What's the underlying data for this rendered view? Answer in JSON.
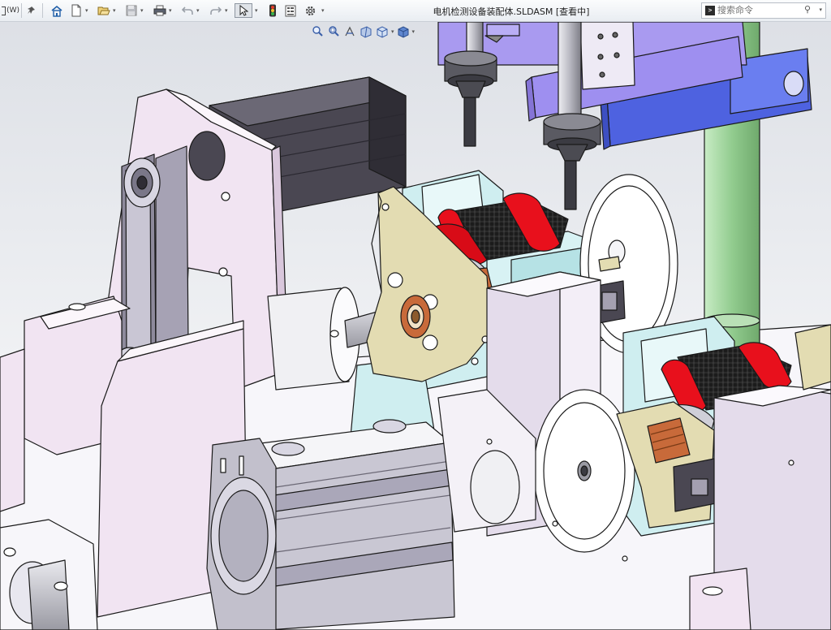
{
  "window": {
    "title": "电机检测设备装配体.SLDASM [查看中]",
    "left_stub_label": "(W)"
  },
  "search": {
    "placeholder": "搜索命令",
    "command_icon": ">"
  },
  "toolbar": {
    "items": [
      "pin-icon",
      "home-icon",
      "new-document-icon",
      "open-icon",
      "save-icon",
      "print-icon",
      "undo-icon",
      "redo-icon",
      "select-icon",
      "rebuild-icon",
      "file-properties-icon",
      "options-icon"
    ]
  },
  "headsup_toolbar": {
    "items": [
      "zoom-to-fit-icon",
      "zoom-to-area-icon",
      "previous-view-icon",
      "section-view-icon",
      "view-orientation-icon",
      "display-style-icon"
    ]
  },
  "colors": {
    "plate_pink": "#f1e4f2",
    "motor_dark": "#4a4752",
    "sensor_cyan": "#cfeef0",
    "bracket_purple": "#a99af0",
    "bracket_blue": "#5a6fe6",
    "post_green": "#a8d9a6",
    "coil_red": "#e8101c",
    "winding_black": "#1e1e1e",
    "brass": "#e3dcb2",
    "copper": "#c86a3a",
    "cylinder_grey": "#c9c7d3"
  }
}
